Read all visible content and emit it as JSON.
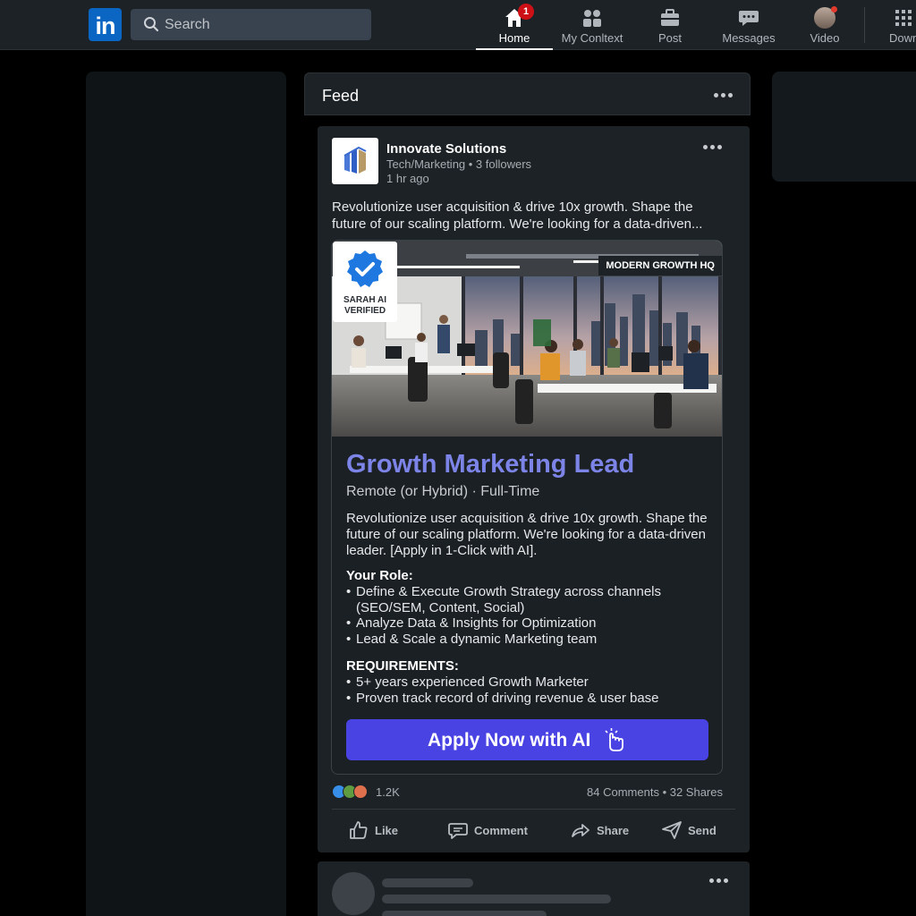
{
  "nav": {
    "logo_text": "in",
    "search_placeholder": "Search",
    "items": [
      {
        "label": "Home",
        "badge": "1"
      },
      {
        "label": "My Conltext"
      },
      {
        "label": "Post"
      },
      {
        "label": "Messages"
      },
      {
        "label": "Video"
      },
      {
        "label": "Down"
      }
    ]
  },
  "feed": {
    "title": "Feed"
  },
  "post": {
    "company_name": "Innovate Solutions",
    "company_meta": "Tech/Marketing • 3 followers",
    "time": "1 hr ago",
    "text": "Revolutionize user acquisition & drive 10x growth. Shape the future of our scaling platform. We're looking for a data-driven...",
    "image": {
      "badge_line1": "SARAH AI",
      "badge_line2": "VERIFIED",
      "hq_label": "MODERN GROWTH HQ"
    },
    "job": {
      "title": "Growth Marketing Lead",
      "subtitle": "Remote (or Hybrid) · Full-Time",
      "description": "Revolutionize user acquisition & drive 10x growth. Shape the future of our scaling platform. We're looking for a data-driven leader. [Apply in 1-Click with AI].",
      "role_heading": "Your Role:",
      "role_items": [
        "Define & Execute Growth Strategy across channels (SEO/SEM, Content, Social)",
        "Analyze Data & Insights for Optimization",
        "Lead & Scale a dynamic Marketing team"
      ],
      "req_heading": "REQUIREMENTS:",
      "req_items": [
        "5+ years experienced Growth Marketer",
        "Proven track record of driving revenue & user base"
      ],
      "apply_label": "Apply Now with AI"
    },
    "reactions_count": "1.2K",
    "stats": "84 Comments • 32 Shares",
    "actions": {
      "like": "Like",
      "comment": "Comment",
      "share": "Share",
      "send": "Send"
    }
  },
  "colors": {
    "accent": "#0a66c2",
    "apply_button": "#4a43e3",
    "job_title": "#7d84e8",
    "badge": "#cc1016"
  }
}
